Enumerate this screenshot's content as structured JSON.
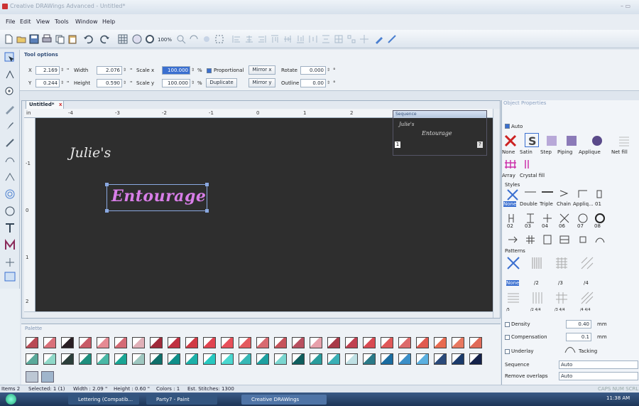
{
  "window": {
    "title": "Creative DRAWings Advanced - Untitled*"
  },
  "menu": [
    "File",
    "Edit",
    "View",
    "Tools",
    "Window",
    "Help"
  ],
  "toolbar": {
    "zoom": "100%"
  },
  "tool_options": {
    "title": "Tool options",
    "x_label": "X",
    "x_value": "2.169",
    "y_label": "Y",
    "y_value": "0.244",
    "width_label": "Width",
    "width_value": "2.076",
    "height_label": "Height",
    "height_value": "0.590",
    "unit": "\"",
    "scalex_label": "Scale x",
    "scalex_value": "100.000",
    "scaley_label": "Scale y",
    "scaley_value": "100.000",
    "percent": "%",
    "proportional_label": "Proportional",
    "duplicate_label": "Duplicate",
    "mirrorx_label": "Mirror x",
    "mirrory_label": "Mirror y",
    "rotate_label": "Rotate",
    "rotate_value": "0.000",
    "outline_label": "Outline",
    "outline_value": "0.00",
    "degree": "°"
  },
  "document": {
    "tab": "Untitled*",
    "ruler_unit": "in",
    "ruler_h": [
      "-4",
      "-3",
      "-2",
      "-1",
      "0",
      "1",
      "2"
    ],
    "ruler_v": [
      "-1",
      "0",
      "1",
      "2"
    ],
    "design_line1": "Julie's",
    "design_line2": "Entourage"
  },
  "sequence": {
    "title": "Sequence",
    "line1": "Julie's",
    "line2": "Entourage",
    "index": "1",
    "marker": "?"
  },
  "object_properties": {
    "title": "Object Properties",
    "auto_label": "Auto",
    "fill_types": [
      "None",
      "Satin",
      "Step",
      "Piping",
      "Applique",
      "Net fill"
    ],
    "fill_types2": [
      "Array",
      "Crystal fill"
    ],
    "styles_label": "Styles",
    "styles_row1": [
      "None",
      "Double",
      "Triple",
      "Chain",
      "Appliq...",
      "01"
    ],
    "styles_row2": [
      "02",
      "03",
      "04",
      "06",
      "07",
      "08"
    ],
    "patterns_label": "Patterns",
    "patterns_row1": [
      "None",
      "/2",
      "/3",
      "/4"
    ],
    "patterns_row2": [
      "/5",
      "/2 4/4",
      "/3 4/4",
      "/4 4/4"
    ],
    "density_label": "Density",
    "density_value": "0.40",
    "mm": "mm",
    "compensation_label": "Compensation",
    "compensation_value": "0.1",
    "underlay_label": "Underlay",
    "tacking_label": "Tacking",
    "sequence_label": "Sequence",
    "sequence_value": "Auto",
    "remove_overlaps_label": "Remove overlaps",
    "remove_overlaps_value": "Auto"
  },
  "palette": {
    "title": "Palette",
    "row1": [
      "#b94a55",
      "#d9707a",
      "#2a1f24",
      "#c85a66",
      "#e58a93",
      "#d46a75",
      "#e0b0b8",
      "#a02a3a",
      "#c03040",
      "#d03a44",
      "#e04450",
      "#e8505a",
      "#e45a5e",
      "#d86a70",
      "#c6525a",
      "#b85060",
      "#e7a0aa",
      "#a83a48",
      "#c04050",
      "#d84a52",
      "#e05858",
      "#dd6a6a",
      "#e05a50",
      "#e86a50",
      "#e87860",
      "#e06a58"
    ],
    "row2": [
      "#5aa99a",
      "#8fd8c8",
      "#2b3e3a",
      "#1f8f7e",
      "#49b8a6",
      "#19a594",
      "#9ec7c0",
      "#0f6f6a",
      "#0f8f8a",
      "#1bb0a8",
      "#27c8c0",
      "#4ad8d0",
      "#37b8b6",
      "#1da0a0",
      "#7ad6d0",
      "#0f5e5e",
      "#2a9c9c",
      "#3ab0b6",
      "#bfe0e4",
      "#2b7a88",
      "#1a6ca0",
      "#3b8fc8",
      "#5bb0e0",
      "#2a4a7a",
      "#1a3a6a",
      "#14224a"
    ]
  },
  "status": {
    "items": "Items 2",
    "selected": "Selected: 1 (1)",
    "width": "Width : 2.09 \"",
    "height": "Height : 0.60 \"",
    "colors": "Colors : 1",
    "stitches": "Est. Stitches: 1300",
    "right": "CAPS NUM SCRL"
  },
  "taskbar": {
    "items": [
      "Lettering (Compatib...",
      "Party7 - Paint",
      "Creative DRAWings"
    ],
    "clock": "11:38 AM"
  },
  "colors": {
    "accent": "#3a6fd0",
    "canvas": "#2e2e2e",
    "design_pink": "#d87ee8",
    "design_white": "#e8e8e8"
  }
}
